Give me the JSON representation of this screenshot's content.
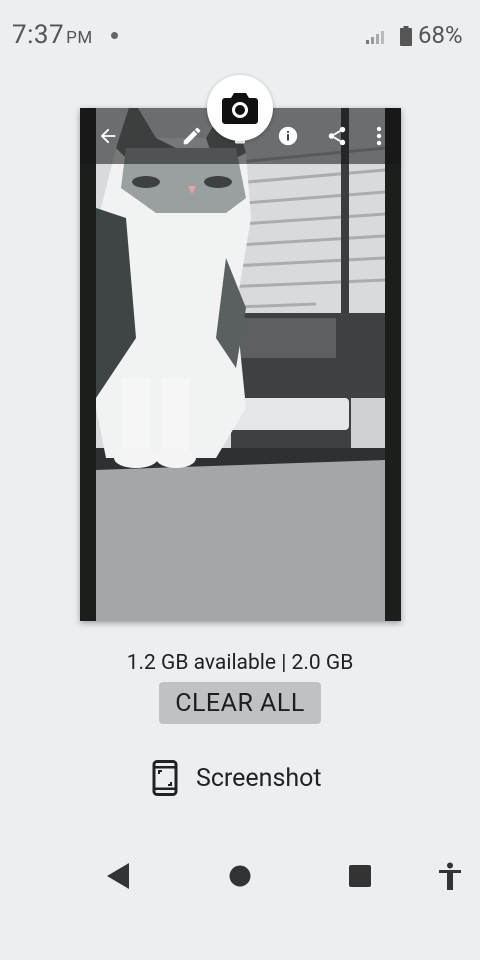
{
  "status": {
    "time": "7:37",
    "ampm": "PM",
    "battery_percent": "68%"
  },
  "preview": {
    "toolbar_icons": [
      "back-arrow-icon",
      "edit-pencil-icon",
      "delete-icon",
      "info-icon",
      "share-icon",
      "more-vert-icon"
    ],
    "fab_icon": "camera-icon"
  },
  "storage": {
    "text": "1.2 GB available | 2.0 GB"
  },
  "actions": {
    "clear_all_label": "CLEAR ALL",
    "screenshot_label": "Screenshot"
  },
  "navbar": {
    "icons": [
      "back-triangle-icon",
      "home-circle-icon",
      "recents-square-icon",
      "accessibility-icon"
    ]
  }
}
